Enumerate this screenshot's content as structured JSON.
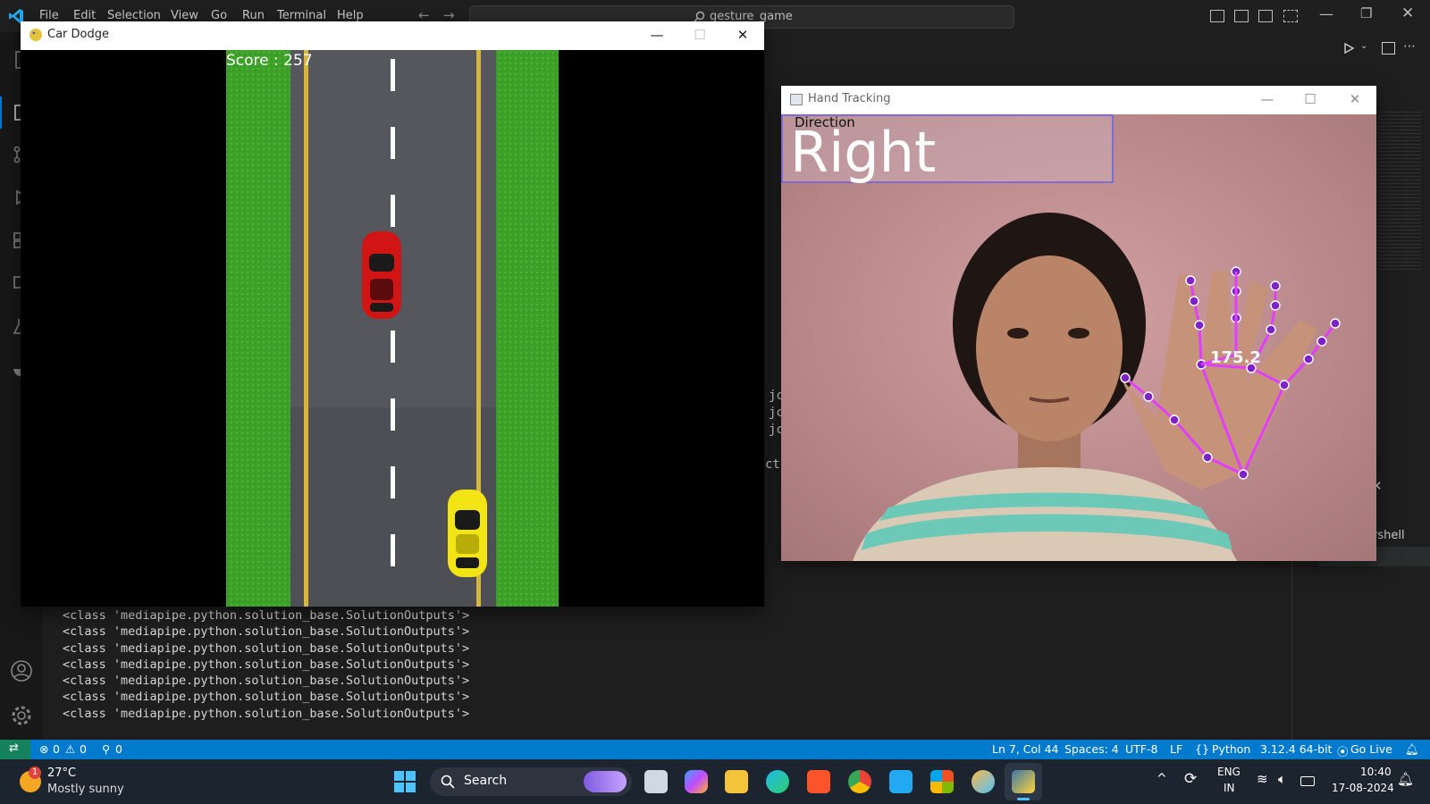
{
  "vscode": {
    "menu": [
      "File",
      "Edit",
      "Selection",
      "View",
      "Go",
      "Run",
      "Terminal",
      "Help"
    ],
    "search_text": "gesture_game",
    "terminal_lines": [
      "<class 'mediapipe.python.solution_base.SolutionOutputs'>",
      "<class 'mediapipe.python.solution_base.SolutionOutputs'>",
      "<class 'mediapipe.python.solution_base.SolutionOutputs'>",
      "<class 'mediapipe.python.solution_base.SolutionOutputs'>",
      "<class 'mediapipe.python.solution_base.SolutionOutputs'>",
      "<class 'mediapipe.python.solution_base.SolutionOutputs'>",
      "<class 'mediapipe.python.solution_base.SolutionOutputs'>"
    ],
    "partial_editor_text": [
      "jc",
      "jc",
      "jc",
      "ct"
    ],
    "partial_shell_text": "rshell",
    "status": {
      "errors": "0",
      "warnings": "0",
      "ports": "0",
      "position": "Ln 7, Col 44",
      "spaces": "Spaces: 4",
      "encoding": "UTF-8",
      "eol": "LF",
      "language": "Python",
      "interpreter": "3.12.4 64-bit",
      "golive": "Go Live"
    }
  },
  "game_window": {
    "title": "Car Dodge",
    "score_text": "Score : 257"
  },
  "tracking_window": {
    "title": "Hand Tracking",
    "direction_label": "Direction",
    "direction_value": "Right",
    "angle_text": "175.2"
  },
  "taskbar": {
    "weather_temp": "27°C",
    "weather_desc": "Mostly sunny",
    "weather_badge": "1",
    "search_label": "Search",
    "lang_top": "ENG",
    "lang_bottom": "IN",
    "time": "10:40",
    "date": "17-08-2024"
  },
  "colors": {
    "statusbar": "#007acc",
    "landmark": "#8a2be2",
    "connection": "#e040fb"
  }
}
